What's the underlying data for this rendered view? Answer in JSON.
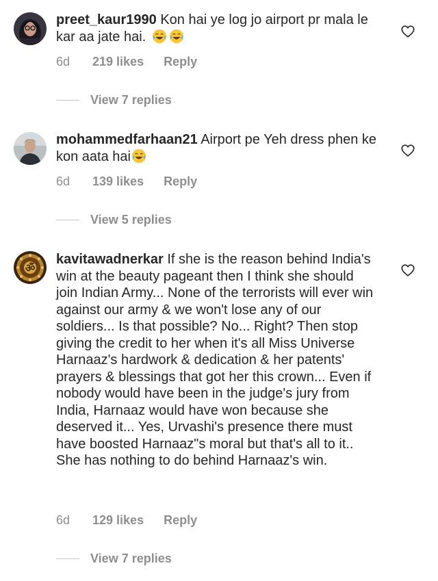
{
  "comments": [
    {
      "username": "preet_kaur1990",
      "text": "Kon hai ye log jo airport pr mala le kar aa jate hai.",
      "emojis": [
        "tears-of-joy-emoji",
        "tears-of-joy-emoji"
      ],
      "time": "6d",
      "likes": "219 likes",
      "reply": "Reply",
      "view_replies": "View 7 replies"
    },
    {
      "username": "mohammedfarhaan21",
      "text": "Airport pe Yeh dress phen ke kon aata hai",
      "emojis": [
        "tears-of-joy-emoji"
      ],
      "time": "6d",
      "likes": "139 likes",
      "reply": "Reply",
      "view_replies": "View 5 replies"
    },
    {
      "username": "kavitawadnerkar",
      "text": "If she is the reason behind India's win at the beauty pageant then I think she should join Indian Army... None of the terrorists will ever win against our army & we won't lose any of our soldiers... Is that possible? No... Right? Then stop giving the credit to her when it's all Miss Universe Harnaaz's hardwork & dedication & her patents' prayers & blessings that got her this crown... Even if nobody would have been in the judge's jury from India, Harnaaz would have won because she deserved it... Yes, Urvashi's presence there must have boosted Harnaaz\"s moral but that's all to it.. She has nothing to do behind Harnaaz's win.",
      "emojis": [],
      "time": "6d",
      "likes": "129 likes",
      "reply": "Reply",
      "view_replies": "View 7 replies"
    }
  ],
  "colors": {
    "text": "#262626",
    "secondary": "#8e8e8e",
    "divider": "#c7c7c7"
  }
}
